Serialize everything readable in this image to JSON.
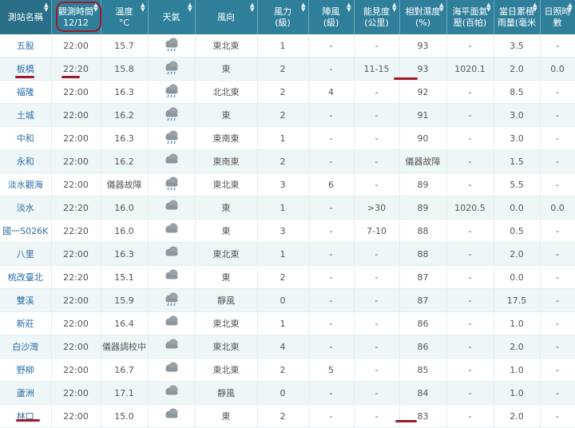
{
  "headers": [
    {
      "l1": "測站名稱",
      "l2": ""
    },
    {
      "l1": "觀測時間",
      "l2": "12/12"
    },
    {
      "l1": "溫度",
      "l2": "°C"
    },
    {
      "l1": "天氣",
      "l2": ""
    },
    {
      "l1": "風向",
      "l2": ""
    },
    {
      "l1": "風力",
      "l2": "(級)"
    },
    {
      "l1": "陣風",
      "l2": "(級)"
    },
    {
      "l1": "能見度",
      "l2": "(公里)"
    },
    {
      "l1": "相對濕度",
      "l2": "(%)"
    },
    {
      "l1": "海平面氣",
      "l2": "壓(百帕)"
    },
    {
      "l1": "當日累積",
      "l2": "雨量(毫米"
    },
    {
      "l1": "日照時數",
      "l2": ""
    }
  ],
  "rows": [
    {
      "station": "五股",
      "time": "22:00",
      "temp": "15.7",
      "weather": "rain-cloud-icon",
      "wind_dir": "東北東",
      "wind": "1",
      "gust": "-",
      "vis": "-",
      "rh": "93",
      "pres": "-",
      "rain": "3.5",
      "sun": "-"
    },
    {
      "station": "板橋",
      "time": "22:20",
      "temp": "15.8",
      "weather": "rain-cloud-icon",
      "wind_dir": "東",
      "wind": "2",
      "gust": "-",
      "vis": "11-15",
      "rh": "93",
      "pres": "1020.1",
      "rain": "2.0",
      "sun": "0.0"
    },
    {
      "station": "福隆",
      "time": "22:00",
      "temp": "16.3",
      "weather": "rain-cloud-icon",
      "wind_dir": "北北東",
      "wind": "2",
      "gust": "4",
      "vis": "-",
      "rh": "92",
      "pres": "-",
      "rain": "8.5",
      "sun": "-"
    },
    {
      "station": "土城",
      "time": "22:00",
      "temp": "16.2",
      "weather": "rain-cloud-icon",
      "wind_dir": "東",
      "wind": "2",
      "gust": "-",
      "vis": "-",
      "rh": "91",
      "pres": "-",
      "rain": "3.0",
      "sun": "-"
    },
    {
      "station": "中和",
      "time": "22:00",
      "temp": "16.3",
      "weather": "rain-cloud-icon",
      "wind_dir": "東南東",
      "wind": "1",
      "gust": "-",
      "vis": "-",
      "rh": "90",
      "pres": "-",
      "rain": "3.0",
      "sun": "-"
    },
    {
      "station": "永和",
      "time": "22:00",
      "temp": "16.2",
      "weather": "cloud-icon",
      "wind_dir": "東南東",
      "wind": "2",
      "gust": "-",
      "vis": "-",
      "rh": "儀器故障",
      "pres": "-",
      "rain": "1.5",
      "sun": "-"
    },
    {
      "station": "淡水觀海",
      "time": "22:00",
      "temp": "儀器故障",
      "weather": "rain-cloud-icon",
      "wind_dir": "東北東",
      "wind": "3",
      "gust": "6",
      "vis": "-",
      "rh": "89",
      "pres": "-",
      "rain": "5.5",
      "sun": "-"
    },
    {
      "station": "淡水",
      "time": "22:20",
      "temp": "16.0",
      "weather": "cloud-icon",
      "wind_dir": "東",
      "wind": "1",
      "gust": "-",
      "vis": ">30",
      "rh": "89",
      "pres": "1020.5",
      "rain": "0.0",
      "sun": "0.0"
    },
    {
      "station": "國一S026K",
      "time": "22:20",
      "temp": "16.0",
      "weather": "cloud-icon",
      "wind_dir": "東",
      "wind": "3",
      "gust": "-",
      "vis": "7-10",
      "rh": "88",
      "pres": "-",
      "rain": "0.5",
      "sun": "-"
    },
    {
      "station": "八里",
      "time": "22:00",
      "temp": "16.3",
      "weather": "cloud-icon",
      "wind_dir": "東北東",
      "wind": "1",
      "gust": "-",
      "vis": "-",
      "rh": "88",
      "pres": "-",
      "rain": "2.0",
      "sun": "-"
    },
    {
      "station": "桃改臺北",
      "time": "22:20",
      "temp": "15.1",
      "weather": "cloud-icon",
      "wind_dir": "東",
      "wind": "2",
      "gust": "-",
      "vis": "-",
      "rh": "87",
      "pres": "-",
      "rain": "0.0",
      "sun": "-"
    },
    {
      "station": "雙溪",
      "time": "22:00",
      "temp": "15.9",
      "weather": "rain-cloud-icon",
      "wind_dir": "靜風",
      "wind": "0",
      "gust": "-",
      "vis": "-",
      "rh": "87",
      "pres": "-",
      "rain": "17.5",
      "sun": "-"
    },
    {
      "station": "新莊",
      "time": "22:00",
      "temp": "16.4",
      "weather": "cloud-icon",
      "wind_dir": "東北東",
      "wind": "1",
      "gust": "-",
      "vis": "-",
      "rh": "86",
      "pres": "-",
      "rain": "1.0",
      "sun": "-"
    },
    {
      "station": "白沙灣",
      "time": "22:00",
      "temp": "儀器調校中",
      "weather": "cloud-icon",
      "wind_dir": "東北東",
      "wind": "4",
      "gust": "-",
      "vis": "-",
      "rh": "86",
      "pres": "-",
      "rain": "2.0",
      "sun": "-"
    },
    {
      "station": "野柳",
      "time": "22:00",
      "temp": "16.7",
      "weather": "cloud-icon",
      "wind_dir": "東北東",
      "wind": "2",
      "gust": "5",
      "vis": "-",
      "rh": "85",
      "pres": "-",
      "rain": "1.0",
      "sun": "-"
    },
    {
      "station": "蘆洲",
      "time": "22:00",
      "temp": "17.1",
      "weather": "cloud-icon",
      "wind_dir": "靜風",
      "wind": "0",
      "gust": "-",
      "vis": "-",
      "rh": "84",
      "pres": "-",
      "rain": "1.0",
      "sun": "-"
    },
    {
      "station": "林口",
      "time": "22:00",
      "temp": "15.0",
      "weather": "cloud-icon",
      "wind_dir": "東",
      "wind": "2",
      "gust": "-",
      "vis": "-",
      "rh": "83",
      "pres": "-",
      "rain": "2.0",
      "sun": "-"
    }
  ],
  "colors": {
    "header": "#2f7f9a",
    "row_alt": "#eef6f8",
    "station_link": "#2b6fa8",
    "annotation": "#9b1b2d"
  }
}
